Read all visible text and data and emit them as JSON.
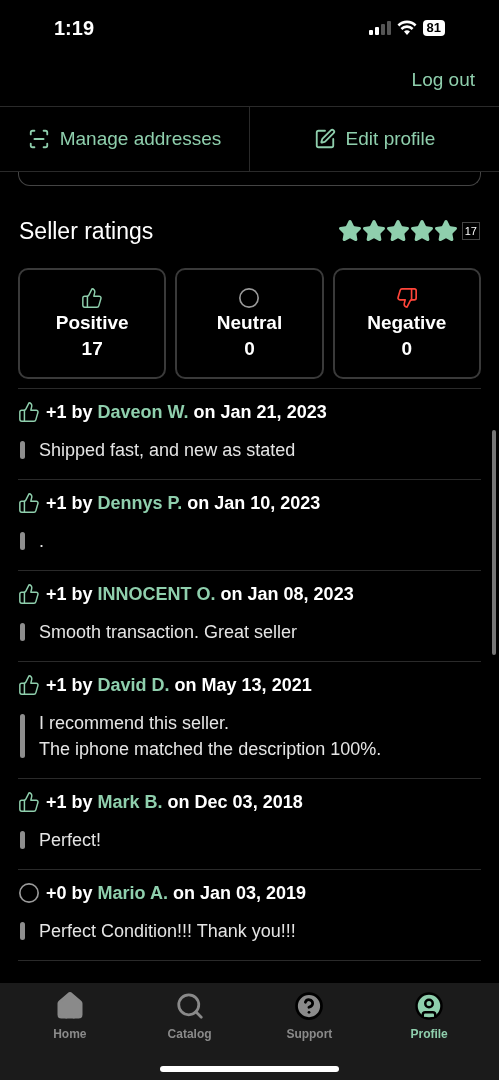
{
  "status_bar": {
    "time": "1:19",
    "battery": "81"
  },
  "header": {
    "logout": "Log out"
  },
  "actions": [
    {
      "kind": "addresses",
      "label": "Manage addresses"
    },
    {
      "kind": "edit",
      "label": "Edit profile"
    }
  ],
  "ratings": {
    "title": "Seller ratings",
    "stars": 5,
    "count": "17",
    "summary": [
      {
        "kind": "positive",
        "label": "Positive",
        "value": "17"
      },
      {
        "kind": "neutral",
        "label": "Neutral",
        "value": "0"
      },
      {
        "kind": "negative",
        "label": "Negative",
        "value": "0"
      }
    ]
  },
  "reviews": [
    {
      "kind": "positive",
      "prefix": "+1 by",
      "name": "Daveon W.",
      "suffix": "on Jan 21, 2023",
      "comment": [
        "Shipped fast, and new as stated"
      ]
    },
    {
      "kind": "positive",
      "prefix": "+1 by",
      "name": "Dennys P.",
      "suffix": "on Jan 10, 2023",
      "comment": [
        "."
      ]
    },
    {
      "kind": "positive",
      "prefix": "+1 by",
      "name": "INNOCENT O.",
      "suffix": "on Jan 08, 2023",
      "comment": [
        "Smooth transaction. Great seller"
      ]
    },
    {
      "kind": "positive",
      "prefix": "+1 by",
      "name": "David D.",
      "suffix": "on May 13, 2021",
      "comment": [
        "I recommend this seller.",
        "The iphone matched the description 100%."
      ]
    },
    {
      "kind": "positive",
      "prefix": "+1 by",
      "name": "Mark B.",
      "suffix": "on Dec 03, 2018",
      "comment": [
        "Perfect!"
      ]
    },
    {
      "kind": "neutral",
      "prefix": "+0 by",
      "name": "Mario A.",
      "suffix": "on Jan 03, 2019",
      "comment": [
        "Perfect Condition!!! Thank you!!!"
      ]
    }
  ],
  "tabs": [
    {
      "kind": "home",
      "label": "Home",
      "selected": false
    },
    {
      "kind": "catalog",
      "label": "Catalog",
      "selected": false
    },
    {
      "kind": "support",
      "label": "Support",
      "selected": false
    },
    {
      "kind": "profile",
      "label": "Profile",
      "selected": true
    }
  ]
}
